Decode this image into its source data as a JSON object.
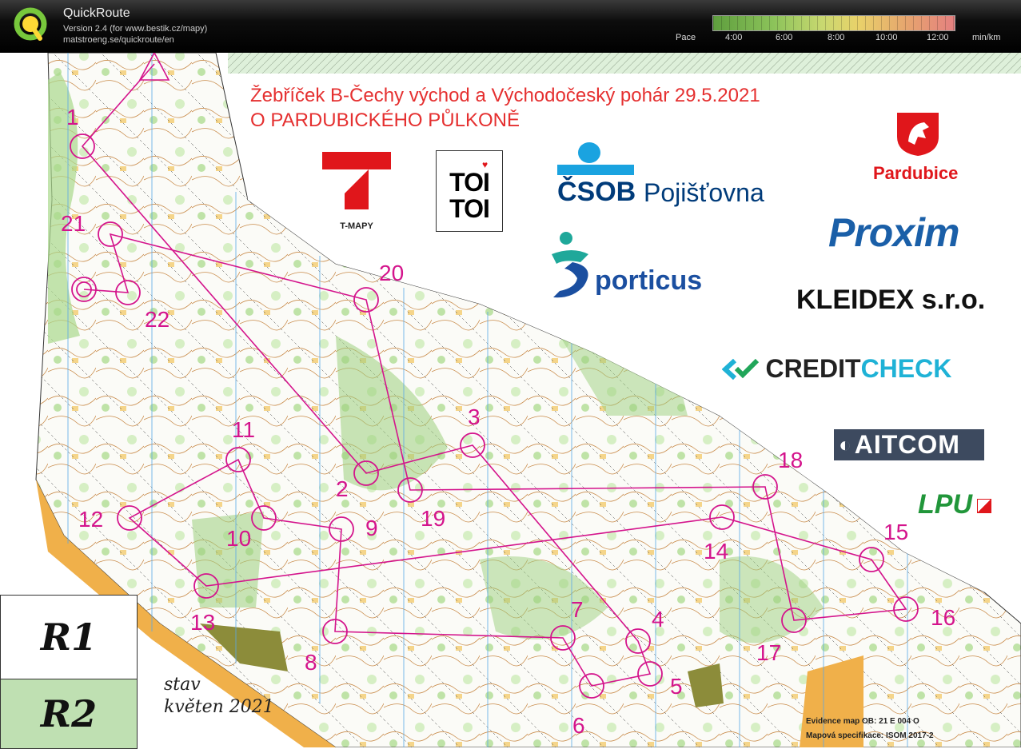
{
  "app": {
    "name": "QuickRoute",
    "version": "Version 2.4  (for www.bestik.cz/mapy)",
    "url": "matstroeng.se/quickroute/en"
  },
  "pace_scale": {
    "label": "Pace",
    "ticks": [
      "4:00",
      "6:00",
      "8:00",
      "10:00",
      "12:00"
    ],
    "unit": "min/km",
    "colors": [
      "#5e9e3e",
      "#8cc35a",
      "#c8d870",
      "#e9d26a",
      "#e6a56e",
      "#e58080"
    ]
  },
  "event": {
    "title": "Žebříček B-Čechy východ a Východočeský pohár  29.5.2021",
    "subtitle": "O PARDUBICKÉHO PŮLKONĚ"
  },
  "sponsors": {
    "tmapy": "T-MAPY",
    "toitoi_line1": "TOI",
    "toitoi_line2": "TOI",
    "csob_brand": "ČSOB",
    "csob_rest": "Pojišťovna",
    "pardubice": "Pardubice",
    "proxim": "Proxim",
    "sporticus": "porticus",
    "kleidex": "KLEIDEX s.r.o.",
    "credit": "CREDIT",
    "check": "CHECK",
    "aitcom": "AITCOM",
    "lpu": "LPU"
  },
  "legend": {
    "r1": "R1",
    "r2": "R2",
    "stav_line1": "stav",
    "stav_line2": "květen 2021"
  },
  "footer": {
    "evidence": "Evidence map OB:  21 E 004 O",
    "spec": "Mapová specifikace: ISOM 2017-2"
  },
  "controls": [
    "1",
    "2",
    "3",
    "4",
    "5",
    "6",
    "7",
    "8",
    "9",
    "10",
    "11",
    "12",
    "13",
    "14",
    "15",
    "16",
    "17",
    "18",
    "19",
    "20",
    "21",
    "22"
  ],
  "colors": {
    "course": "#d4148c",
    "title_red": "#e53030",
    "csob_blue": "#003b7a",
    "proxim_blue": "#1a5fa8",
    "credit_teal": "#1fb2d6"
  }
}
